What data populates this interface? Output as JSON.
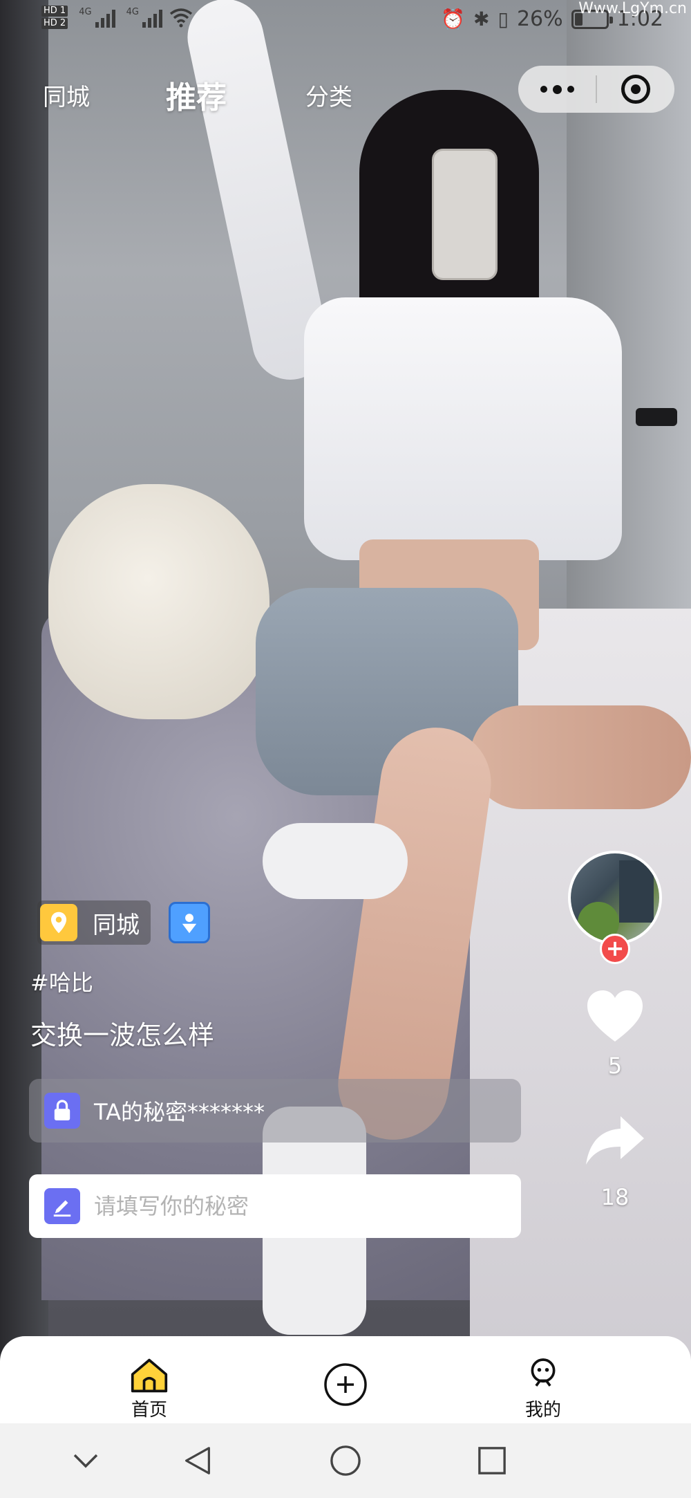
{
  "status_bar": {
    "sim1": "HD 1",
    "sim2": "HD 2",
    "network1": "4G",
    "network2": "4G",
    "battery_percent": "26%",
    "battery_level": 0.26,
    "time": "1:02",
    "watermark": "Www.LgYm.cn"
  },
  "top_nav": {
    "tabs": [
      {
        "label": "同城",
        "active": false
      },
      {
        "label": "推荐",
        "active": true
      },
      {
        "label": "分类",
        "active": false
      }
    ],
    "accent_color": "#ff7a2c"
  },
  "capsule": {
    "more_icon": "more-dots-icon",
    "close_icon": "target-icon"
  },
  "side_actions": {
    "avatar_icon": "avatar",
    "follow_symbol": "+",
    "like_count": "5",
    "share_count": "18"
  },
  "post": {
    "location_tag": "同城",
    "hashtag": "#哈比",
    "caption": "交换一波怎么样",
    "secret_text": "TA的秘密*******",
    "secret_input_placeholder": "请填写你的秘密"
  },
  "tab_bar": {
    "items": [
      {
        "label": "首页",
        "icon": "home-icon",
        "active": true
      },
      {
        "label": "",
        "icon": "add-circle-icon",
        "active": false
      },
      {
        "label": "我的",
        "icon": "profile-icon",
        "active": false
      }
    ],
    "active_color": "#ffd23a"
  },
  "system_nav": {
    "buttons": [
      "chevron-down-icon",
      "back-icon",
      "home-circle-icon",
      "recents-icon"
    ]
  }
}
